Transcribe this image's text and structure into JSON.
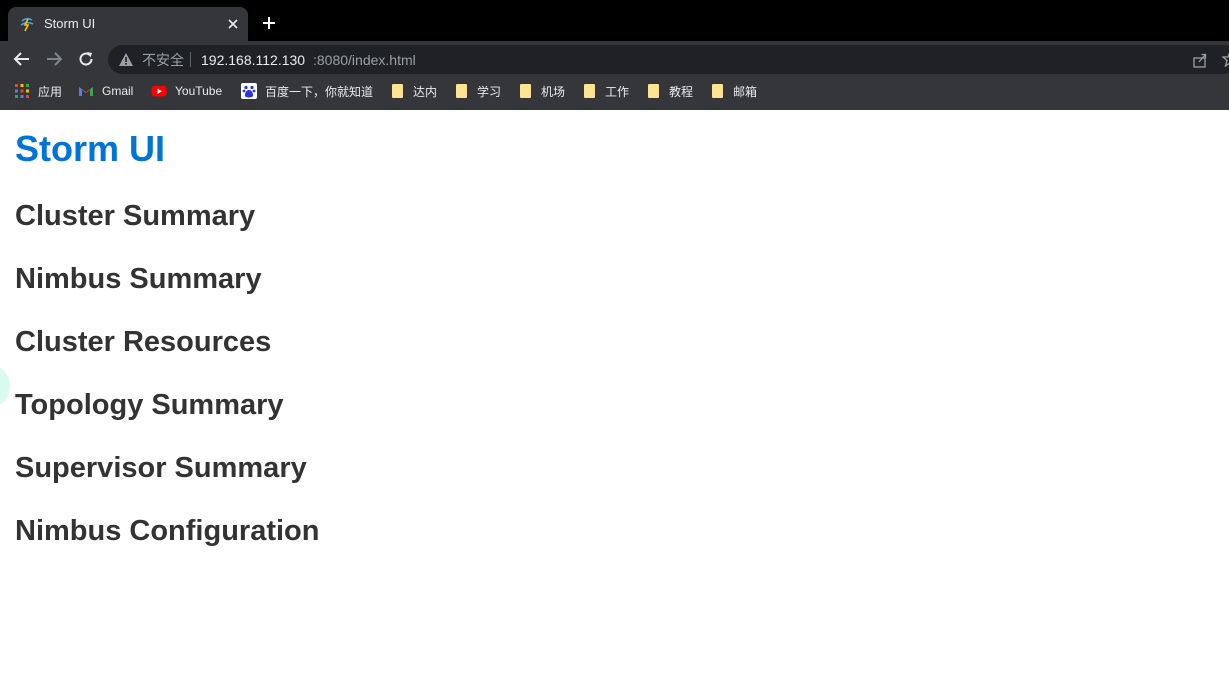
{
  "browser": {
    "tab": {
      "title": "Storm UI"
    },
    "omnibox": {
      "security_label": "不安全",
      "url_host": "192.168.112.130",
      "url_rest": ":8080/index.html"
    },
    "bookmarks": [
      {
        "label": "应用",
        "icon": "apps-grid-icon"
      },
      {
        "label": "Gmail",
        "icon": "gmail-icon"
      },
      {
        "label": "YouTube",
        "icon": "youtube-icon"
      },
      {
        "label": "百度一下，你就知道",
        "icon": "baidu-icon"
      },
      {
        "label": "达内",
        "icon": "folder-icon"
      },
      {
        "label": "学习",
        "icon": "folder-icon"
      },
      {
        "label": "机场",
        "icon": "folder-icon"
      },
      {
        "label": "工作",
        "icon": "folder-icon"
      },
      {
        "label": "教程",
        "icon": "folder-icon"
      },
      {
        "label": "邮箱",
        "icon": "folder-icon"
      }
    ]
  },
  "page": {
    "title": "Storm UI",
    "sections": [
      "Cluster Summary",
      "Nimbus Summary",
      "Cluster Resources",
      "Topology Summary",
      "Supervisor Summary",
      "Nimbus Configuration"
    ]
  },
  "colors": {
    "title_blue": "#0074d9",
    "heading_gray": "#333333",
    "chrome_dark": "#35363a"
  }
}
